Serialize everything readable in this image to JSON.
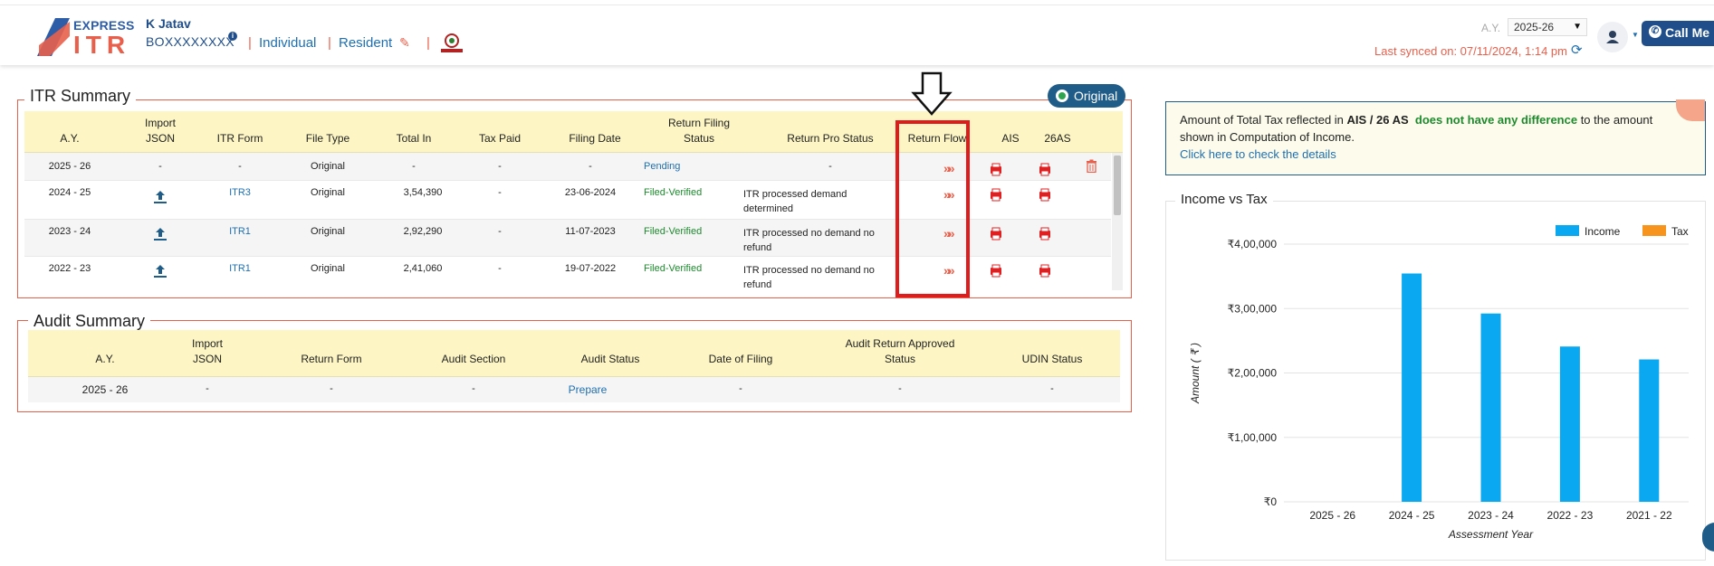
{
  "header": {
    "logo_top": "EXPRESS",
    "logo_main": "ITR",
    "user_name": "K Jatav",
    "pan": "BOXXXXXXXX",
    "status_individual": "Individual",
    "status_resident": "Resident",
    "ay_label": "A.Y.",
    "ay_value": "2025-26",
    "last_synced": "Last synced on: 07/11/2024, 1:14 pm",
    "call_me": "Call Me"
  },
  "itr_summary": {
    "title": "ITR Summary",
    "badge": "Original",
    "columns": [
      {
        "l1": "",
        "l2": "A.Y."
      },
      {
        "l1": "Import",
        "l2": "JSON"
      },
      {
        "l1": "",
        "l2": "ITR Form"
      },
      {
        "l1": "",
        "l2": "File Type"
      },
      {
        "l1": "",
        "l2": "Total In"
      },
      {
        "l1": "",
        "l2": "Tax Paid"
      },
      {
        "l1": "",
        "l2": "Filing Date"
      },
      {
        "l1": "Return Filing",
        "l2": "Status"
      },
      {
        "l1": "",
        "l2": "Return Pro Status"
      },
      {
        "l1": "",
        "l2": "Return Flow"
      },
      {
        "l1": "",
        "l2": "AIS"
      },
      {
        "l1": "",
        "l2": "26AS"
      }
    ],
    "rows": [
      {
        "ay": "2025 - 26",
        "import": "-",
        "form": "-",
        "file_type": "Original",
        "total_in": "-",
        "tax_paid": "-",
        "filing_date": "-",
        "status": "Pending",
        "pro_status_1": "-",
        "pro_status_2": "",
        "flow": "»»",
        "has_upload": false,
        "has_delete": true
      },
      {
        "ay": "2024 - 25",
        "import": "",
        "form": "ITR3",
        "file_type": "Original",
        "total_in": "3,54,390",
        "tax_paid": "-",
        "filing_date": "23-06-2024",
        "status": "Filed-Verified",
        "pro_status_1": "ITR processed demand",
        "pro_status_2": "determined",
        "flow": "»»",
        "has_upload": true,
        "has_delete": false
      },
      {
        "ay": "2023 - 24",
        "import": "",
        "form": "ITR1",
        "file_type": "Original",
        "total_in": "2,92,290",
        "tax_paid": "-",
        "filing_date": "11-07-2023",
        "status": "Filed-Verified",
        "pro_status_1": "ITR processed no demand no",
        "pro_status_2": "refund",
        "flow": "»»",
        "has_upload": true,
        "has_delete": false
      },
      {
        "ay": "2022 - 23",
        "import": "",
        "form": "ITR1",
        "file_type": "Original",
        "total_in": "2,41,060",
        "tax_paid": "-",
        "filing_date": "19-07-2022",
        "status": "Filed-Verified",
        "pro_status_1": "ITR processed no demand no",
        "pro_status_2": "refund",
        "flow": "»»",
        "has_upload": true,
        "has_delete": false
      }
    ]
  },
  "audit_summary": {
    "title": "Audit Summary",
    "columns": [
      {
        "l1": "",
        "l2": "A.Y."
      },
      {
        "l1": "Import",
        "l2": "JSON"
      },
      {
        "l1": "",
        "l2": "Return Form"
      },
      {
        "l1": "",
        "l2": "Audit Section"
      },
      {
        "l1": "",
        "l2": "Audit Status"
      },
      {
        "l1": "",
        "l2": "Date of Filing"
      },
      {
        "l1": "Audit Return Approved",
        "l2": "Status"
      },
      {
        "l1": "",
        "l2": "UDIN Status"
      }
    ],
    "row": {
      "ay": "2025 - 26",
      "import": "-",
      "form": "-",
      "section": "-",
      "status": "Prepare",
      "date": "-",
      "approved": "-",
      "udin": "-"
    }
  },
  "notice": {
    "part1": "Amount of Total Tax reflected in ",
    "part2": "AIS / 26 AS",
    "part3": "does not have any difference",
    "part4": " to the amount",
    "line2": "shown in Computation of Income.",
    "link": "Click here to check the details"
  },
  "chart_data": {
    "type": "bar",
    "title": "Income vs Tax",
    "categories": [
      "2025 - 26",
      "2024 - 25",
      "2023 - 24",
      "2022 - 23",
      "2021 - 22"
    ],
    "series": [
      {
        "name": "Income",
        "color": "#0aa8f0",
        "values": [
          0,
          354390,
          292290,
          241060,
          221000
        ]
      },
      {
        "name": "Tax",
        "color": "#f7941d",
        "values": [
          0,
          0,
          0,
          0,
          0
        ]
      }
    ],
    "xlabel": "Assessment Year",
    "ylabel": "Amount ( ₹ )",
    "ylim": [
      0,
      400000
    ],
    "yticks": [
      {
        "value": 0,
        "label": "₹0"
      },
      {
        "value": 100000,
        "label": "₹1,00,000"
      },
      {
        "value": 200000,
        "label": "₹2,00,000"
      },
      {
        "value": 300000,
        "label": "₹3,00,000"
      },
      {
        "value": 400000,
        "label": "₹4,00,000"
      }
    ],
    "legend": "top-right",
    "grid": true
  }
}
